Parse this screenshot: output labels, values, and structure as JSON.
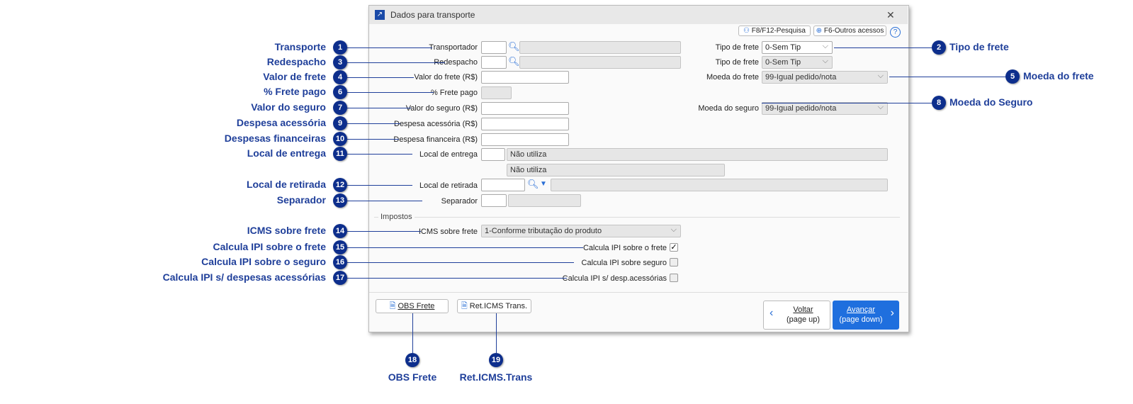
{
  "window": {
    "title": "Dados para transporte",
    "close": "✕"
  },
  "toolbar": {
    "search": "F8/F12-Pesquisa",
    "other": "F6-Outros acessos",
    "help": "?"
  },
  "fields": {
    "transportador": "Transportador",
    "redespacho": "Redespacho",
    "valor_frete": "Valor do frete (R$)",
    "frete_pago": "% Frete pago",
    "valor_seguro": "Valor do seguro (R$)",
    "despesa_acessoria": "Despesa acessória (R$)",
    "despesa_financeira": "Despesa financeira (R$)",
    "local_entrega": "Local de entrega",
    "local_entrega_value": "Não utiliza",
    "local_entrega_value2": "Não utiliza",
    "local_retirada": "Local de retirada",
    "separador": "Separador",
    "tipo_frete": "Tipo de frete",
    "tipo_frete_value": "0-Sem Tip",
    "tipo_frete2": "Tipo de frete",
    "tipo_frete2_value": "0-Sem Tip",
    "moeda_frete": "Moeda do frete",
    "moeda_frete_value": "99-Igual pedido/nota",
    "moeda_seguro": "Moeda do seguro",
    "moeda_seguro_value": "99-Igual pedido/nota"
  },
  "impostos": {
    "group": "Impostos",
    "icms": "ICMS sobre frete",
    "icms_value": "1-Conforme tributação do produto",
    "ipi_frete": "Calcula IPI sobre o frete",
    "ipi_frete_checked": true,
    "ipi_seguro": "Calcula IPI sobre seguro",
    "ipi_seguro_checked": false,
    "ipi_desp": "Calcula IPI s/ desp.acessórias",
    "ipi_desp_checked": false
  },
  "footer": {
    "obs": "OBS Frete",
    "ret": "Ret.ICMS Trans.",
    "voltar": "Voltar",
    "voltar_sub": "(page up)",
    "avancar": "Avançar",
    "avancar_sub": "(page down)"
  },
  "callouts": [
    {
      "n": "1",
      "label": "Transporte"
    },
    {
      "n": "2",
      "label": "Tipo de frete"
    },
    {
      "n": "3",
      "label": "Redespacho"
    },
    {
      "n": "4",
      "label": "Valor de frete"
    },
    {
      "n": "5",
      "label": "Moeda do frete"
    },
    {
      "n": "6",
      "label": "% Frete pago"
    },
    {
      "n": "7",
      "label": "Valor do seguro"
    },
    {
      "n": "8",
      "label": "Moeda do Seguro"
    },
    {
      "n": "9",
      "label": "Despesa acessória"
    },
    {
      "n": "10",
      "label": "Despesas financeiras"
    },
    {
      "n": "11",
      "label": "Local de entrega"
    },
    {
      "n": "12",
      "label": "Local de retirada"
    },
    {
      "n": "13",
      "label": "Separador"
    },
    {
      "n": "14",
      "label": "ICMS sobre frete"
    },
    {
      "n": "15",
      "label": "Calcula IPI sobre o frete"
    },
    {
      "n": "16",
      "label": "Calcula IPI sobre o seguro"
    },
    {
      "n": "17",
      "label": "Calcula IPI s/ despesas acessórias"
    },
    {
      "n": "18",
      "label": "OBS Frete"
    },
    {
      "n": "19",
      "label": "Ret.ICMS.Trans"
    }
  ]
}
